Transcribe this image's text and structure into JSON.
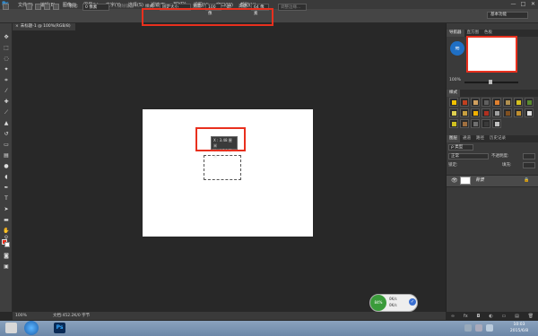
{
  "app": {
    "logo": "Ps"
  },
  "menu": [
    "文件(F)",
    "编辑(E)",
    "图像(I)",
    "图层(L)",
    "文字(Y)",
    "选择(S)",
    "滤镜(T)",
    "3D(D)",
    "视图(V)",
    "窗口(W)",
    "帮助(H)"
  ],
  "window_controls": {
    "minimize": "—",
    "restore": "□",
    "close": "✕"
  },
  "options": {
    "feather_label": "羽化:",
    "feather_value": "0 像素",
    "antialias": "消除锯齿",
    "style_label": "样式:",
    "style_value": "固定大小",
    "width_label": "宽度:",
    "width_value": "100 像",
    "height_label": "高度:",
    "height_value": "64 像素",
    "refine_edge": "调整边缘...",
    "swap_icon": "⇄",
    "workspace": "基本功能"
  },
  "document": {
    "tab": "未标题-1 @ 100%(RGB/8)",
    "close": "×"
  },
  "tooltip": {
    "x_line": "X : 3.48 厘米",
    "y_line": "Y : 4.34 厘米"
  },
  "status": {
    "zoom": "100%",
    "doc": "文档:452.2K/0 字节"
  },
  "navigator": {
    "tabs": [
      "导航器",
      "直方图",
      "色板"
    ],
    "zoom": "100%"
  },
  "styles_tab": "样式",
  "layers": {
    "tabs": [
      "图层",
      "通道",
      "路径",
      "历史记录"
    ],
    "kind": "ρ 类型",
    "blend_mode": "正常",
    "opacity_label": "不透明度:",
    "lock_label": "锁定:",
    "fill_label": "填充:",
    "layer_name": "背景",
    "footer_icons": [
      "∞",
      "fx",
      "◘",
      "◐",
      "▭",
      "▤",
      "🗑"
    ]
  },
  "net_widget": {
    "percent": "84%",
    "up": "0K/s",
    "down": "0K/s"
  },
  "clock": {
    "time": "10:03",
    "date": "2015/6/8"
  }
}
